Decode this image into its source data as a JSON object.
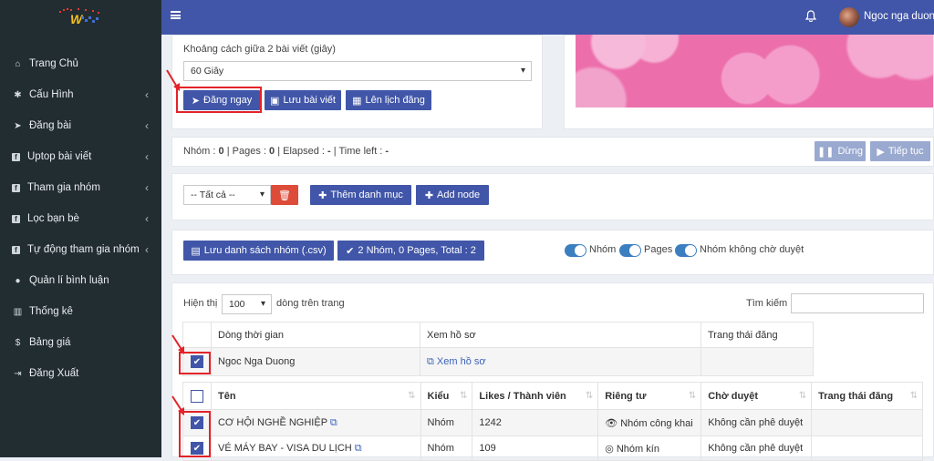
{
  "sidebar": {
    "brand_letter": "W",
    "items": [
      {
        "label": "Trang Chủ",
        "icon": "home-icon",
        "glyph": "⌂",
        "chevron": false
      },
      {
        "label": "Cấu Hình",
        "icon": "gear-icon",
        "glyph": "✱",
        "chevron": true
      },
      {
        "label": "Đăng bài",
        "icon": "paper-plane-icon",
        "glyph": "➤",
        "chevron": true
      },
      {
        "label": "Uptop bài viết",
        "icon": "facebook-icon",
        "glyph": "f",
        "chevron": true
      },
      {
        "label": "Tham gia nhóm",
        "icon": "facebook-icon",
        "glyph": "f",
        "chevron": true
      },
      {
        "label": "Lọc bạn bè",
        "icon": "facebook-icon",
        "glyph": "f",
        "chevron": true
      },
      {
        "label": "Tự động tham gia nhóm",
        "icon": "facebook-icon",
        "glyph": "f",
        "chevron": true
      },
      {
        "label": "Quản lí bình luận",
        "icon": "comment-icon",
        "glyph": "●",
        "chevron": false
      },
      {
        "label": "Thống kê",
        "icon": "bar-chart-icon",
        "glyph": "▥",
        "chevron": false
      },
      {
        "label": "Bảng giá",
        "icon": "dollar-icon",
        "glyph": "$",
        "chevron": false
      },
      {
        "label": "Đăng Xuất",
        "icon": "sign-out-icon",
        "glyph": "⇥",
        "chevron": false
      }
    ]
  },
  "topbar": {
    "menu_icon": "hamburger-icon",
    "bell_glyph": "🔔",
    "user_name": "Ngoc nga duong"
  },
  "post": {
    "interval_label": "Khoảng cách giữa 2 bài viết (giây)",
    "interval_value": "60 Giây",
    "post_now_label": "Đăng ngay",
    "save_post_label": "Lưu bài viết",
    "schedule_label": "Lên lịch đăng"
  },
  "progress": {
    "groups_label": "Nhóm :",
    "groups_value": "0",
    "pages_label": "| Pages :",
    "pages_value": "0",
    "elapsed_label": "| Elapsed :",
    "elapsed_value": "-",
    "timeleft_label": "| Time left :",
    "timeleft_value": "-",
    "stop_label": "Dừng",
    "continue_label": "Tiếp tục"
  },
  "category": {
    "select_value": "-- Tất cả --",
    "add_category_label": "Thêm danh mục",
    "add_node_label": "Add node"
  },
  "group_actions": {
    "save_csv_label": "Lưu danh sách nhóm (.csv)",
    "summary_label": "2 Nhóm, 0 Pages, Total : 2",
    "toggle_groups": "Nhóm",
    "toggle_pages": "Pages",
    "toggle_no_wait": "Nhóm không chờ duyệt"
  },
  "table_controls": {
    "show_label": "Hiện thị",
    "page_size": "100",
    "rows_label": "dòng trên trang",
    "search_label": "Tìm kiếm"
  },
  "profile_table": {
    "headers": [
      "Dòng thời gian",
      "Xem hồ sơ",
      "Trang thái đăng"
    ],
    "row": {
      "name": "Ngoc Nga Duong",
      "view_label": "Xem hồ sơ",
      "status": ""
    }
  },
  "group_table": {
    "headers": [
      "Tên",
      "Kiểu",
      "Likes / Thành viên",
      "Riêng tư",
      "Chờ duyệt",
      "Trang thái đăng"
    ],
    "rows": [
      {
        "name": "CƠ HỘI NGHỀ NGHIỆP",
        "type": "Nhóm",
        "members": "1242",
        "privacy": "Nhóm công khai",
        "approval": "Không cần phê duyệt",
        "status": ""
      },
      {
        "name": "VÉ MÁY BAY - VISA DU LỊCH",
        "type": "Nhóm",
        "members": "109",
        "privacy": "Nhóm kín",
        "approval": "Không cần phê duyệt",
        "status": ""
      }
    ]
  },
  "colors": {
    "primary": "#4156a8",
    "sidebar": "#222d32",
    "danger": "#dd4b39",
    "highlight": "#e32329"
  }
}
